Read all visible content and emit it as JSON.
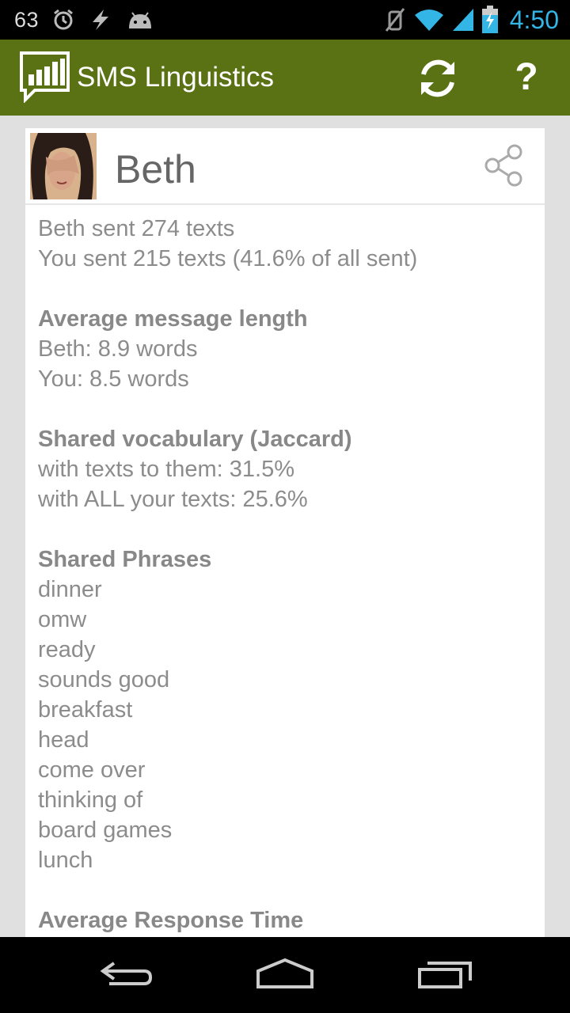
{
  "status_bar": {
    "left_number": "63",
    "time": "4:50",
    "icons": [
      "alarm-icon",
      "flash-icon",
      "android-icon",
      "mute-icon",
      "wifi-icon",
      "signal-icon",
      "battery-charging-icon"
    ]
  },
  "action_bar": {
    "title": "SMS Linguistics",
    "help_label": "?",
    "colors": {
      "background": "#5a7214",
      "accent": "#33b5e5"
    }
  },
  "contact": {
    "name": "Beth"
  },
  "summary": {
    "line1": "Beth sent 274 texts",
    "line2": "You sent 215 texts (41.6% of all sent)"
  },
  "avg_length": {
    "title": "Average message length",
    "line1": "Beth: 8.9 words",
    "line2": "You: 8.5 words"
  },
  "vocabulary": {
    "title": "Shared vocabulary (Jaccard)",
    "line1": "with texts to them: 31.5%",
    "line2": "with ALL your texts: 25.6%"
  },
  "phrases": {
    "title": "Shared Phrases",
    "items": [
      "dinner",
      "omw",
      "ready",
      "sounds good",
      "breakfast",
      "head",
      "come over",
      "thinking of",
      "board games",
      "lunch"
    ]
  },
  "response_time": {
    "title": "Average Response Time"
  }
}
